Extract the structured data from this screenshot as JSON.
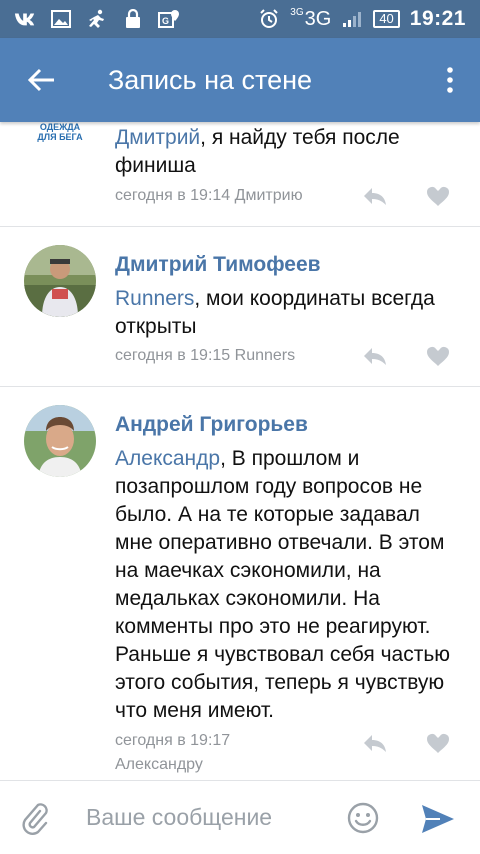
{
  "status_bar": {
    "network_small": "3G",
    "network": "3G",
    "battery": "40",
    "time": "19:21"
  },
  "toolbar": {
    "title": "Запись на стене"
  },
  "partial_logo": {
    "line1": "ОДЕЖДА",
    "line2": "ДЛЯ БЕГА"
  },
  "comments": [
    {
      "mention": "Дмитрий",
      "text": ", я найду тебя после финиша",
      "meta": "сегодня в 19:14 Дмитрию"
    },
    {
      "author": "Дмитрий Тимофеев",
      "mention": "Runners",
      "text": ", мои координаты всегда открыты",
      "meta": "сегодня в 19:15 Runners"
    },
    {
      "author": "Андрей Григорьев",
      "mention": "Александр",
      "text": ", В прошлом и позапрошлом году вопросов не было. А на те которые задавал мне оперативно отвечали. В этом на маечках сэкономили, на медальках сэкономили. На комменты про это не реагируют. Раньше я чувствовал себя частью этого события, теперь я чувствую что меня имеют.",
      "meta_line1": "сегодня в 19:17",
      "meta_line2": "Александру"
    }
  ],
  "composer": {
    "placeholder": "Ваше сообщение"
  },
  "colors": {
    "status_bar": "#4a6e94",
    "toolbar": "#5181b8",
    "link": "#4a76a8",
    "send": "#5181b8"
  }
}
